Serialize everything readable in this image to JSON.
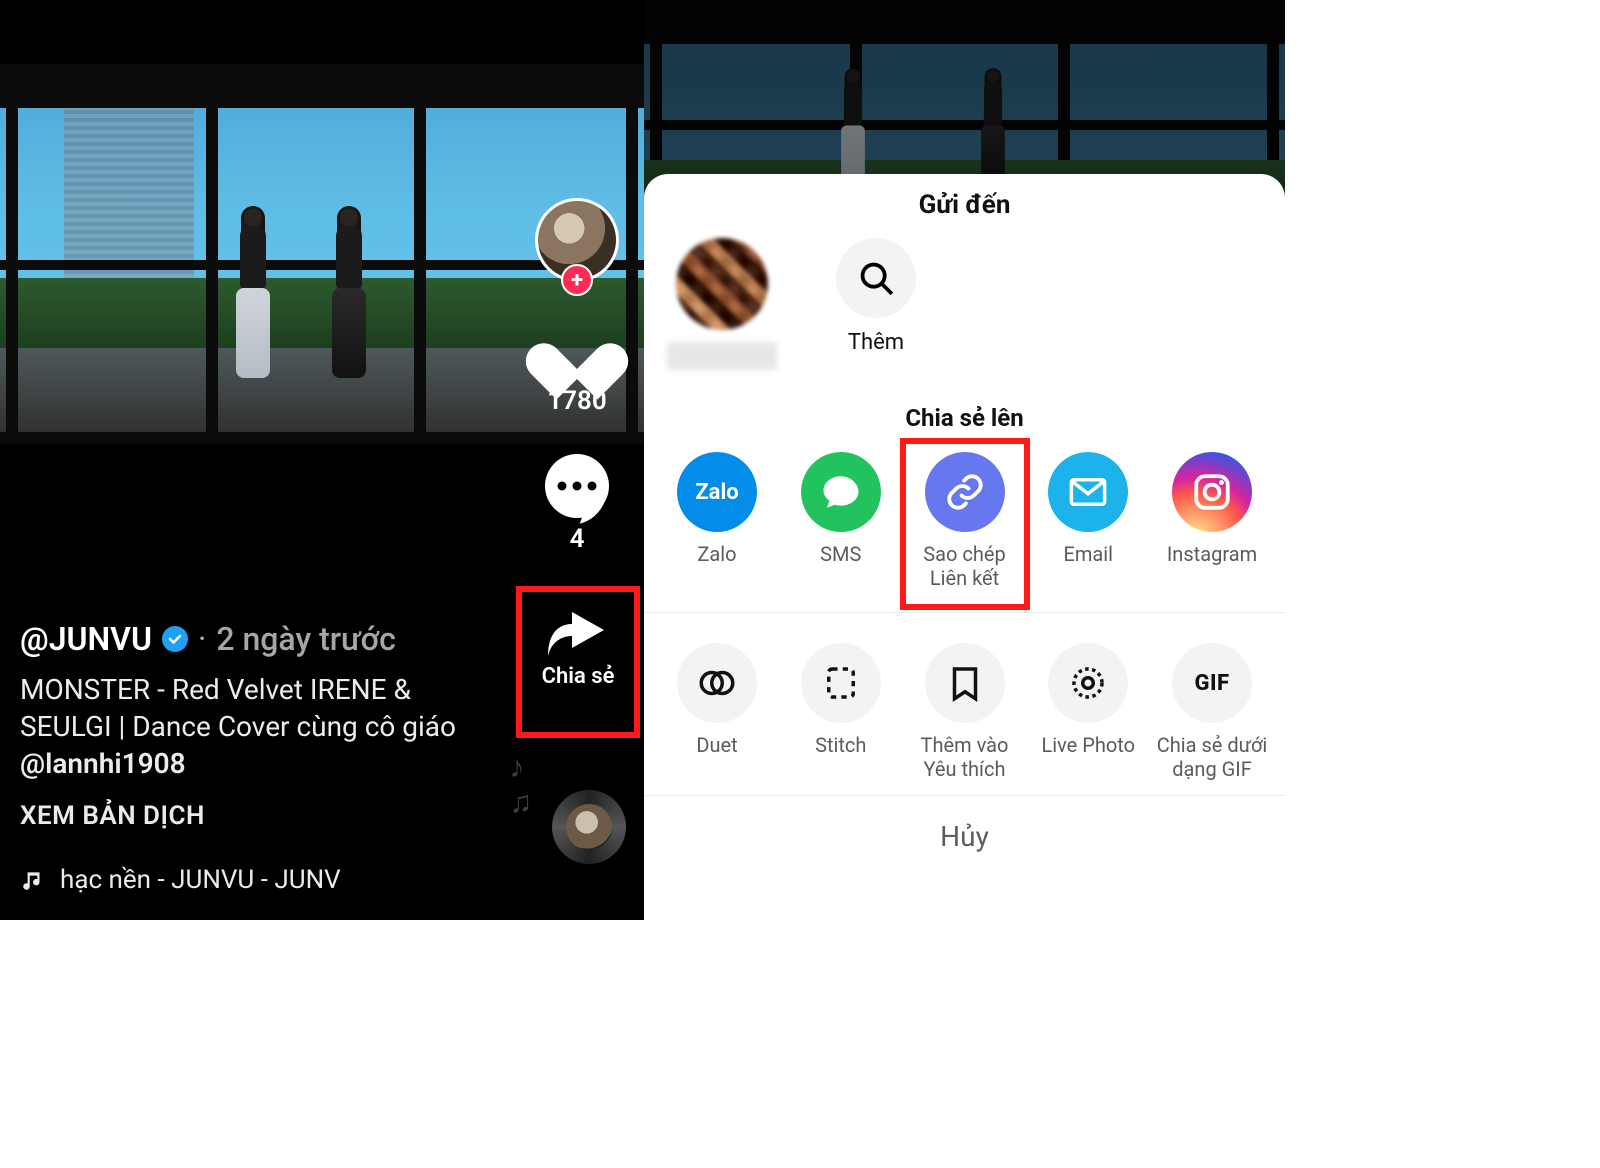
{
  "left": {
    "username": "@JUNVU",
    "time_sep": "·",
    "time": "2 ngày trước",
    "caption_line1": "MONSTER - Red Velvet IRENE & SEULGI | Dance Cover cùng cô giáo",
    "mention": "@lannhi1908",
    "translate": "XEM BẢN DỊCH",
    "sound_prefix": "hạc nền - JUNVU - JUNV",
    "likes": "1780",
    "comments": "4",
    "share_label": "Chia sẻ"
  },
  "right": {
    "send_title": "Gửi đến",
    "more_label": "Thêm",
    "share_title": "Chia sẻ lên",
    "share_opts": [
      {
        "key": "zalo",
        "label": "Zalo",
        "text": "Zalo"
      },
      {
        "key": "sms",
        "label": "SMS"
      },
      {
        "key": "copy",
        "label": "Sao chép Liên kết",
        "hi": true
      },
      {
        "key": "email",
        "label": "Email"
      },
      {
        "key": "insta",
        "label": "Instagram"
      }
    ],
    "act_opts": [
      {
        "key": "duet",
        "label": "Duet"
      },
      {
        "key": "stitch",
        "label": "Stitch"
      },
      {
        "key": "fav",
        "label": "Thêm vào Yêu thích"
      },
      {
        "key": "live",
        "label": "Live Photo"
      },
      {
        "key": "gif",
        "label": "Chia sẻ dưới dạng GIF",
        "text": "GIF"
      }
    ],
    "cancel": "Hủy"
  }
}
